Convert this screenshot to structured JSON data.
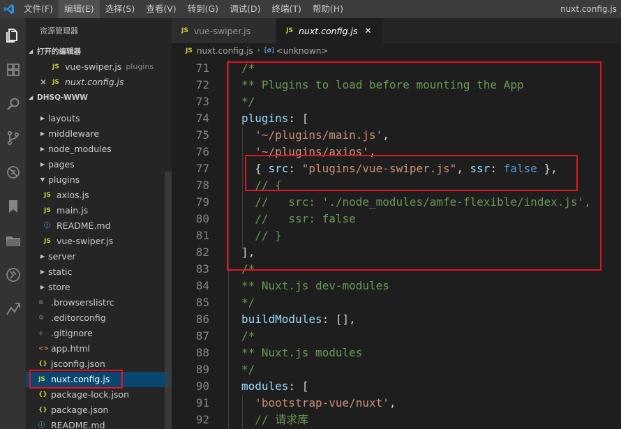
{
  "menu": {
    "items": [
      "文件(F)",
      "编辑(E)",
      "选择(S)",
      "查看(V)",
      "转到(G)",
      "调试(D)",
      "终端(T)",
      "帮助(H)"
    ],
    "active_index": 1,
    "window_title": "nuxt.config.js"
  },
  "activity_icons": [
    "files-icon",
    "extensions-icon",
    "search-icon",
    "source-control-icon",
    "debug-icon",
    "bookmark-icon",
    "folder-icon",
    "remote-icon",
    "share-icon"
  ],
  "sidebar": {
    "title": "资源管理器",
    "open_editors_label": "打开的编辑器",
    "open_editors": [
      {
        "name": "vue-swiper.js",
        "desc": "plugins"
      },
      {
        "name": "nuxt.config.js",
        "desc": ""
      }
    ],
    "project_label": "DHSQ-WWW",
    "tree": [
      {
        "name": "layouts",
        "type": "folder"
      },
      {
        "name": "middleware",
        "type": "folder"
      },
      {
        "name": "node_modules",
        "type": "folder"
      },
      {
        "name": "pages",
        "type": "folder"
      },
      {
        "name": "plugins",
        "type": "folder-open"
      },
      {
        "name": "axios.js",
        "type": "js",
        "indent": 1
      },
      {
        "name": "main.js",
        "type": "js",
        "indent": 1
      },
      {
        "name": "README.md",
        "type": "info",
        "indent": 1
      },
      {
        "name": "vue-swiper.js",
        "type": "js",
        "indent": 1
      },
      {
        "name": "server",
        "type": "folder"
      },
      {
        "name": "static",
        "type": "folder"
      },
      {
        "name": "store",
        "type": "folder"
      },
      {
        "name": ".browserslistrc",
        "type": "lines"
      },
      {
        "name": ".editorconfig",
        "type": "gear"
      },
      {
        "name": ".gitignore",
        "type": "git"
      },
      {
        "name": "app.html",
        "type": "html"
      },
      {
        "name": "jsconfig.json",
        "type": "json"
      },
      {
        "name": "nuxt.config.js",
        "type": "js",
        "selected": true
      },
      {
        "name": "package-lock.json",
        "type": "json"
      },
      {
        "name": "package.json",
        "type": "json"
      },
      {
        "name": "README.md",
        "type": "info"
      }
    ],
    "file_icons": {
      "js": "JS",
      "json": "{}"
    }
  },
  "tabs": [
    {
      "label": "vue-swiper.js",
      "active": false
    },
    {
      "label": "nuxt.config.js",
      "active": true
    }
  ],
  "breadcrumb": {
    "file": "nuxt.config.js",
    "symbol": "<unknown>"
  },
  "code": {
    "lines": [
      {
        "n": "71",
        "tokens": [
          [
            "c-com",
            "/*"
          ]
        ]
      },
      {
        "n": "72",
        "tokens": [
          [
            "c-com",
            "** Plugins to load before mounting the App"
          ]
        ]
      },
      {
        "n": "73",
        "tokens": [
          [
            "c-com",
            "*/"
          ]
        ]
      },
      {
        "n": "74",
        "tokens": [
          [
            "c-key",
            "plugins"
          ],
          [
            "c-pun",
            ": ["
          ]
        ]
      },
      {
        "n": "75",
        "tokens": [
          [
            "c-pun",
            "  "
          ],
          [
            "c-str",
            "'~/plugins/main.js'"
          ],
          [
            "c-pun",
            ","
          ]
        ]
      },
      {
        "n": "76",
        "tokens": [
          [
            "c-pun",
            "  "
          ],
          [
            "c-str",
            "'~/plugins/axios'"
          ],
          [
            "c-pun",
            ","
          ]
        ]
      },
      {
        "n": "77",
        "tokens": [
          [
            "c-pun",
            "  { "
          ],
          [
            "c-key",
            "src"
          ],
          [
            "c-pun",
            ": "
          ],
          [
            "c-str",
            "\"plugins/vue-swiper.js\""
          ],
          [
            "c-pun",
            ", "
          ],
          [
            "c-key",
            "ssr"
          ],
          [
            "c-pun",
            ": "
          ],
          [
            "c-kw",
            "false"
          ],
          [
            "c-pun",
            " },"
          ]
        ]
      },
      {
        "n": "78",
        "tokens": [
          [
            "c-pun",
            "  "
          ],
          [
            "c-com",
            "// {"
          ]
        ]
      },
      {
        "n": "79",
        "tokens": [
          [
            "c-pun",
            "  "
          ],
          [
            "c-com",
            "//   src: './node_modules/amfe-flexible/index.js',"
          ]
        ]
      },
      {
        "n": "80",
        "tokens": [
          [
            "c-pun",
            "  "
          ],
          [
            "c-com",
            "//   ssr: false"
          ]
        ]
      },
      {
        "n": "81",
        "tokens": [
          [
            "c-pun",
            "  "
          ],
          [
            "c-com",
            "// }"
          ]
        ]
      },
      {
        "n": "82",
        "tokens": [
          [
            "c-pun",
            "],"
          ]
        ]
      },
      {
        "n": "83",
        "tokens": [
          [
            "c-com",
            "/*"
          ]
        ]
      },
      {
        "n": "84",
        "tokens": [
          [
            "c-com",
            "** Nuxt.js dev-modules"
          ]
        ]
      },
      {
        "n": "85",
        "tokens": [
          [
            "c-com",
            "*/"
          ]
        ]
      },
      {
        "n": "86",
        "tokens": [
          [
            "c-key",
            "buildModules"
          ],
          [
            "c-pun",
            ": [],"
          ]
        ]
      },
      {
        "n": "87",
        "tokens": [
          [
            "c-com",
            "/*"
          ]
        ]
      },
      {
        "n": "88",
        "tokens": [
          [
            "c-com",
            "** Nuxt.js modules"
          ]
        ]
      },
      {
        "n": "89",
        "tokens": [
          [
            "c-com",
            "*/"
          ]
        ]
      },
      {
        "n": "90",
        "tokens": [
          [
            "c-key",
            "modules"
          ],
          [
            "c-pun",
            ": ["
          ]
        ]
      },
      {
        "n": "91",
        "tokens": [
          [
            "c-pun",
            "  "
          ],
          [
            "c-str",
            "'bootstrap-vue/nuxt'"
          ],
          [
            "c-pun",
            ","
          ]
        ]
      },
      {
        "n": "92",
        "tokens": [
          [
            "c-pun",
            "  "
          ],
          [
            "c-com",
            "// 请求库"
          ]
        ]
      }
    ]
  },
  "annotation_color": "#e81123"
}
